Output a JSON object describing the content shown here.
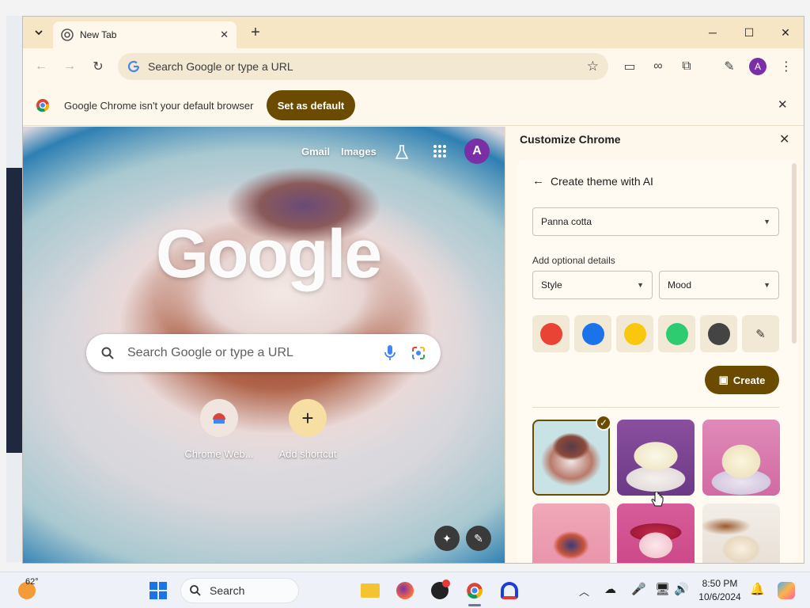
{
  "window": {
    "tab_title": "New Tab",
    "new_tab_label": "+"
  },
  "toolbar": {
    "omnibox_placeholder": "Search Google or type a URL",
    "avatar_letter": "A"
  },
  "infobar": {
    "message": "Google Chrome isn't your default browser",
    "button": "Set as default"
  },
  "ntp": {
    "links": [
      "Gmail",
      "Images"
    ],
    "logo_text": "Google",
    "search_placeholder": "Search Google or type a URL",
    "avatar_letter": "A",
    "shortcuts": [
      {
        "label": "Chrome Web..."
      },
      {
        "label": "Add shortcut"
      }
    ]
  },
  "panel": {
    "title": "Customize Chrome",
    "subpage_title": "Create theme with AI",
    "subject_value": "Panna cotta",
    "optional_label": "Add optional details",
    "style_value": "Style",
    "mood_value": "Mood",
    "swatches": [
      "#e94335",
      "#1a73e8",
      "#f9c80e",
      "#2ecc71",
      "#444444"
    ],
    "create_label": "Create"
  },
  "taskbar": {
    "weather": "62°",
    "search_label": "Search",
    "time": "8:50 PM",
    "date": "10/6/2024"
  },
  "colors": {
    "accent": "#6b4b00",
    "tab_strip": "#f7e6c6",
    "surface": "#fdf7ec"
  }
}
